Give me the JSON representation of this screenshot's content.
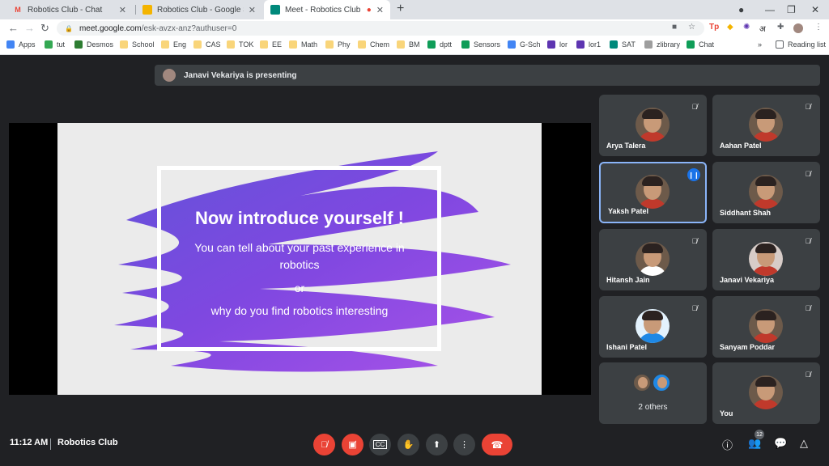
{
  "browser": {
    "tabs": [
      {
        "title": "Robotics Club - Chat",
        "favicon": "M",
        "color": "#ea4335"
      },
      {
        "title": "Robotics Club - Google Slides",
        "favicon": "",
        "color": "#f4b400"
      },
      {
        "title": "Meet - Robotics Club",
        "favicon": "",
        "color": "#00897b"
      }
    ],
    "url_host": "meet.google.com",
    "url_path": "/esk-avzx-anz?authuser=0",
    "bookmarks": [
      {
        "label": "Apps",
        "color": "#4285f4"
      },
      {
        "label": "tut",
        "color": "#34a853"
      },
      {
        "label": "Desmos",
        "color": "#2e7d32"
      },
      {
        "label": "School",
        "color": "#f9d57a"
      },
      {
        "label": "Eng",
        "color": "#f9d57a"
      },
      {
        "label": "CAS",
        "color": "#f9d57a"
      },
      {
        "label": "TOK",
        "color": "#f9d57a"
      },
      {
        "label": "EE",
        "color": "#f9d57a"
      },
      {
        "label": "Math",
        "color": "#f9d57a"
      },
      {
        "label": "Phy",
        "color": "#f9d57a"
      },
      {
        "label": "Chem",
        "color": "#f9d57a"
      },
      {
        "label": "BM",
        "color": "#f9d57a"
      },
      {
        "label": "dptt",
        "color": "#0f9d58"
      },
      {
        "label": "Sensors",
        "color": "#0f9d58"
      },
      {
        "label": "G-Sch",
        "color": "#4285f4"
      },
      {
        "label": "lor",
        "color": "#5e35b1"
      },
      {
        "label": "lor1",
        "color": "#5e35b1"
      },
      {
        "label": "SAT",
        "color": "#00897b"
      },
      {
        "label": "zlibrary",
        "color": "#9e9e9e"
      },
      {
        "label": "Chat",
        "color": "#0f9d58"
      }
    ],
    "reading_list": "Reading list"
  },
  "meet": {
    "presenting_text": "Janavi Vekariya is presenting",
    "slide": {
      "title": "Now introduce yourself !",
      "line1": "You can tell about your past experience in",
      "line2": "robotics",
      "line3": "or",
      "line4": "why do you find robotics interesting"
    },
    "participants": [
      {
        "name": "Arya Talera",
        "muted": true,
        "shirt": "#c0392b"
      },
      {
        "name": "Aahan Patel",
        "muted": true,
        "shirt": "#c0392b"
      },
      {
        "name": "Yaksh Patel",
        "muted": false,
        "speaking": true,
        "shirt": "#c0392b"
      },
      {
        "name": "Siddhant Shah",
        "muted": true,
        "shirt": "#c0392b"
      },
      {
        "name": "Hitansh Jain",
        "muted": true,
        "shirt": "#ffffff"
      },
      {
        "name": "Janavi Vekariya",
        "muted": true,
        "shirt": "#c0392b"
      },
      {
        "name": "Ishani Patel",
        "muted": true,
        "shirt": "#1e88e5"
      },
      {
        "name": "Sanyam Poddar",
        "muted": true,
        "shirt": "#c0392b"
      },
      {
        "name": "You",
        "muted": true,
        "shirt": "#c0392b"
      }
    ],
    "others_label": "2 others",
    "time": "11:12 AM",
    "meeting_name": "Robotics Club",
    "people_count": "12"
  }
}
